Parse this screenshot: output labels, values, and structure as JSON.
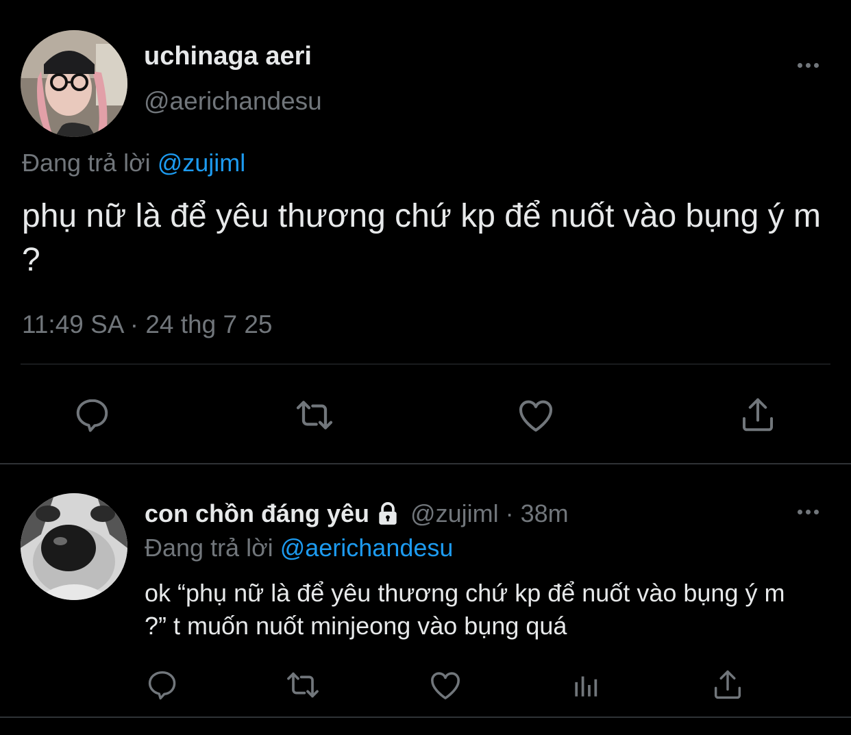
{
  "main_tweet": {
    "display_name": "uchinaga aeri",
    "handle": "@aerichandesu",
    "replying_prefix": "Đang trả lời",
    "replying_to": "@zujiml",
    "text": "phụ nữ là để yêu thương chứ kp để nuốt vào bụng ý m ?",
    "meta": "11:49 SA · 24 thg 7 25",
    "actions": [
      "reply-icon",
      "retweet-icon",
      "like-icon",
      "share-icon"
    ]
  },
  "reply_tweet": {
    "display_name": "con chồn đáng yêu",
    "handle": "@zujiml",
    "separator": "·",
    "time": "38m",
    "replying_prefix": "Đang trả lời",
    "replying_to": "@aerichandesu",
    "text": "ok “phụ nữ là để yêu thương chứ kp để nuốt vào bụng ý m ?” t muốn nuốt minjeong vào bụng quá",
    "actions": [
      "reply-icon",
      "retweet-icon",
      "like-icon",
      "analytics-icon",
      "share-icon"
    ]
  },
  "colors": {
    "background": "#000000",
    "primary_text": "#e7e9ea",
    "secondary_text": "#71767b",
    "link": "#1d9bf0",
    "divider": "#2f3336"
  }
}
